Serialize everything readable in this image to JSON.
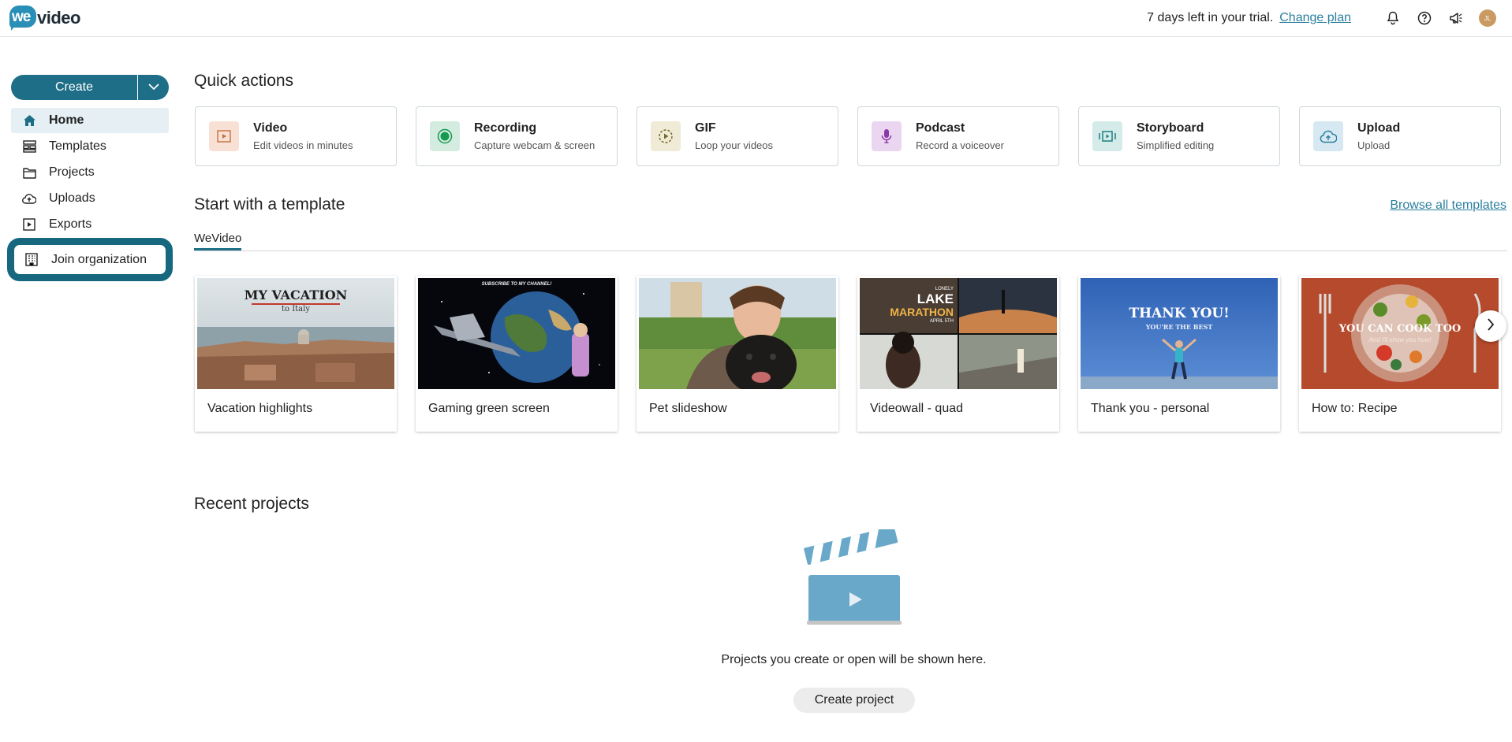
{
  "app": {
    "logo_we": "we",
    "logo_text": "video"
  },
  "header": {
    "trial_text": "7 days left in your trial.",
    "change_plan": "Change plan",
    "avatar_initials": "JL"
  },
  "sidebar": {
    "create_label": "Create",
    "items": [
      {
        "label": "Home",
        "icon": "home-icon",
        "active": true
      },
      {
        "label": "Templates",
        "icon": "templates-icon"
      },
      {
        "label": "Projects",
        "icon": "folder-icon"
      },
      {
        "label": "Uploads",
        "icon": "cloud-upload-icon"
      },
      {
        "label": "Exports",
        "icon": "export-play-icon"
      }
    ],
    "join_org": "Join organization"
  },
  "quick_actions": {
    "title": "Quick actions",
    "items": [
      {
        "title": "Video",
        "sub": "Edit videos in minutes",
        "color": "#f8e1d4",
        "icon": "video-icon"
      },
      {
        "title": "Recording",
        "sub": "Capture webcam & screen",
        "color": "#d3ecdf",
        "icon": "record-icon"
      },
      {
        "title": "GIF",
        "sub": "Loop your videos",
        "color": "#efebd6",
        "icon": "gif-icon"
      },
      {
        "title": "Podcast",
        "sub": "Record a voiceover",
        "color": "#ebd6f1",
        "icon": "microphone-icon"
      },
      {
        "title": "Storyboard",
        "sub": "Simplified editing",
        "color": "#d5ebea",
        "icon": "storyboard-icon"
      },
      {
        "title": "Upload",
        "sub": "Upload",
        "color": "#d6e8f1",
        "icon": "upload-icon"
      }
    ]
  },
  "templates": {
    "title": "Start with a template",
    "browse_all": "Browse all templates",
    "tab": "WeVideo",
    "items": [
      {
        "name": "Vacation highlights",
        "thumb_title": "MY VACATION",
        "thumb_sub": "to Italy"
      },
      {
        "name": "Gaming green screen",
        "thumb_title": "SUBSCRIBE TO MY CHANNEL!"
      },
      {
        "name": "Pet slideshow"
      },
      {
        "name": "Videowall - quad",
        "thumb_title": "LONELY",
        "thumb_title2": "LAKE",
        "thumb_title3": "MARATHON",
        "thumb_sub": "APRIL 5TH"
      },
      {
        "name": "Thank you - personal",
        "thumb_title": "THANK YOU!",
        "thumb_sub": "YOU'RE THE BEST"
      },
      {
        "name": "How to: Recipe",
        "thumb_title": "YOU CAN COOK TOO",
        "thumb_sub": "And I'll show you how!"
      }
    ]
  },
  "recent": {
    "title": "Recent projects",
    "empty_text": "Projects you create or open will be shown here.",
    "create_project": "Create project"
  }
}
